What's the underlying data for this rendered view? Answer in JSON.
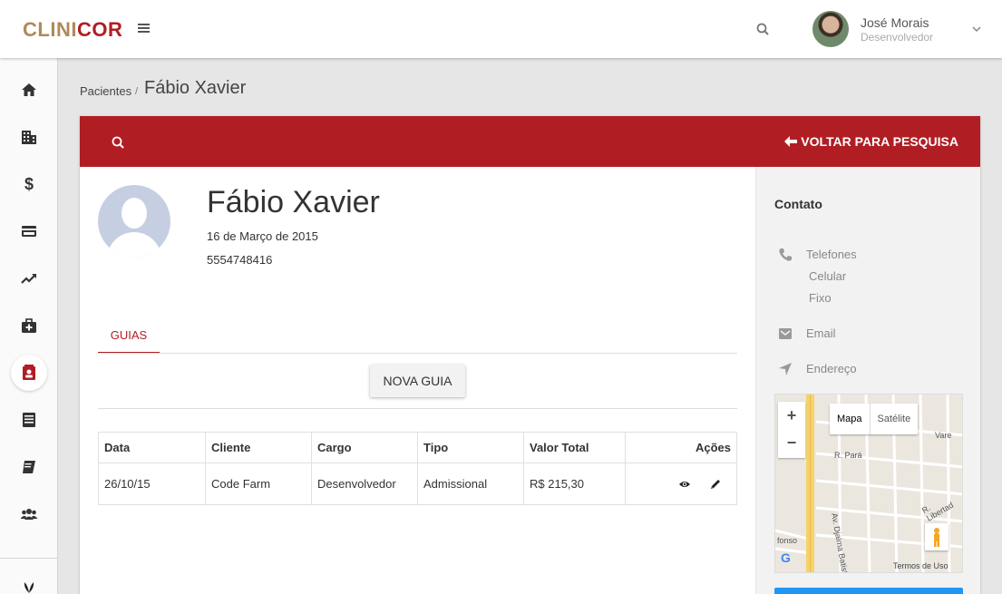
{
  "brand": {
    "part1": "CLINI",
    "part2": "COR"
  },
  "user": {
    "name": "José Morais",
    "role": "Desenvolvedor"
  },
  "breadcrumb": {
    "parent": "Pacientes",
    "separator": "/",
    "current": "Fábio Xavier"
  },
  "header": {
    "back_label": "VOLTAR PARA PESQUISA"
  },
  "patient": {
    "name": "Fábio Xavier",
    "date": "16 de Março de 2015",
    "phone": "5554748416"
  },
  "tabs": [
    {
      "label": "GUIAS"
    }
  ],
  "actions": {
    "new_guide": "NOVA GUIA"
  },
  "table": {
    "headers": [
      "Data",
      "Cliente",
      "Cargo",
      "Tipo",
      "Valor Total",
      "Ações"
    ],
    "rows": [
      {
        "data": "26/10/15",
        "cliente": "Code Farm",
        "cargo": "Desenvolvedor",
        "tipo": "Admissional",
        "valor": "R$ 215,30"
      }
    ]
  },
  "contact": {
    "title": "Contato",
    "phones_label": "Telefones",
    "mobile_label": "Celular",
    "landline_label": "Fixo",
    "email_label": "Email",
    "address_label": "Endereço"
  },
  "map": {
    "type_map": "Mapa",
    "type_satellite": "Satélite",
    "zoom_in": "+",
    "zoom_out": "−",
    "terms": "Termos de Uso",
    "labels": {
      "para": "R. Pará",
      "djalma": "Av. Djalma Batist",
      "libertad": "R. Libertad",
      "fonso": "fonso",
      "var": "Vare"
    }
  },
  "sidebar": {
    "items": [
      "home-icon",
      "building-icon",
      "dollar-icon",
      "credit-card-icon",
      "trending-up-icon",
      "medical-kit-icon",
      "contacts-icon",
      "list-icon",
      "book-icon",
      "users-icon"
    ],
    "active": "contacts-icon"
  },
  "colors": {
    "brand_red": "#b01e24",
    "brand_gold": "#b08a5b",
    "accent_blue": "#2196f3"
  }
}
